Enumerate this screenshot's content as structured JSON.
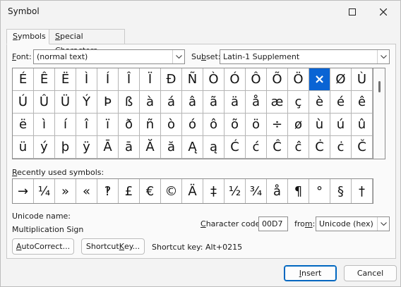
{
  "window": {
    "title": "Symbol"
  },
  "tabs": [
    {
      "prefix": "",
      "key": "S",
      "rest": "ymbols"
    },
    {
      "prefix": "",
      "key": "S",
      "rest": "pecial Characters"
    }
  ],
  "font": {
    "prefix": "",
    "key": "F",
    "rest": "ont:",
    "value": "(normal text)"
  },
  "subset": {
    "prefix": "Su",
    "key": "b",
    "rest": "set:",
    "value": "Latin-1 Supplement"
  },
  "symbols": [
    "É",
    "Ê",
    "Ë",
    "Ì",
    "Í",
    "Î",
    "Ï",
    "Đ",
    "Ñ",
    "Ò",
    "Ó",
    "Ô",
    "Õ",
    "Ö",
    "×",
    "Ø",
    "Ù",
    "Ú",
    "Û",
    "Ü",
    "Ý",
    "Þ",
    "ß",
    "à",
    "á",
    "â",
    "ã",
    "ä",
    "å",
    "æ",
    "ç",
    "è",
    "é",
    "ê",
    "ë",
    "ì",
    "í",
    "î",
    "ï",
    "ð",
    "ñ",
    "ò",
    "ó",
    "ô",
    "õ",
    "ö",
    "÷",
    "ø",
    "ù",
    "ú",
    "û",
    "ü",
    "ý",
    "þ",
    "ÿ",
    "Ā",
    "ā",
    "Ă",
    "ă",
    "Ą",
    "ą",
    "Ć",
    "ć",
    "Ĉ",
    "ĉ",
    "Ċ",
    "ċ",
    "Č"
  ],
  "selected_symbol": "×",
  "recent": {
    "label_prefix": "",
    "label_key": "R",
    "label_rest": "ecently used symbols:",
    "items": [
      "→",
      "¼",
      "»",
      "«",
      "‽",
      "£",
      "€",
      "©",
      "Ä",
      "‡",
      "½",
      "¾",
      "å",
      "¶",
      "°",
      "§",
      "†"
    ]
  },
  "unicode_name": {
    "label": "Unicode name:",
    "value": "Multiplication Sign"
  },
  "char_code": {
    "prefix": "",
    "key": "C",
    "rest": "haracter code:",
    "value": "00D7"
  },
  "from": {
    "prefix": "fro",
    "key": "m",
    "rest": ":",
    "value": "Unicode (hex)"
  },
  "buttons": {
    "autocorrect": {
      "prefix": "",
      "key": "A",
      "rest": "utoCorrect..."
    },
    "shortcut_key": {
      "prefix": "Shortcut ",
      "key": "K",
      "rest": "ey..."
    },
    "insert": {
      "prefix": "",
      "key": "I",
      "rest": "nsert"
    },
    "cancel": "Cancel"
  },
  "shortcut_text": "Shortcut key: Alt+0215"
}
